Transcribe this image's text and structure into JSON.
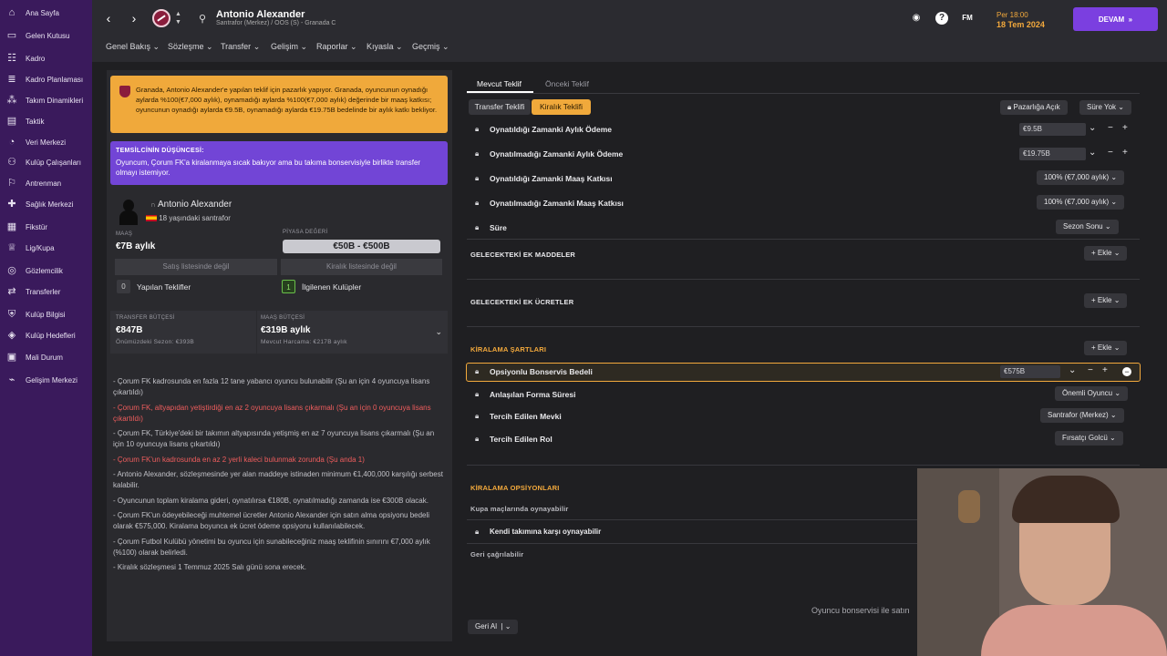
{
  "sidebar": {
    "items": [
      {
        "label": "Ana Sayfa",
        "icon": "home-icon"
      },
      {
        "label": "Gelen Kutusu",
        "icon": "inbox-icon"
      },
      {
        "label": "Kadro",
        "icon": "squad-icon"
      },
      {
        "label": "Kadro Planlaması",
        "icon": "planner-icon"
      },
      {
        "label": "Takım Dinamikleri",
        "icon": "dynamics-icon"
      },
      {
        "label": "Taktik",
        "icon": "tactics-icon"
      },
      {
        "label": "Veri Merkezi",
        "icon": "data-icon"
      },
      {
        "label": "Kulüp Çalışanları",
        "icon": "staff-icon"
      },
      {
        "label": "Antrenman",
        "icon": "training-icon"
      },
      {
        "label": "Sağlık Merkezi",
        "icon": "medical-icon"
      },
      {
        "label": "Fikstür",
        "icon": "calendar-icon"
      },
      {
        "label": "Lig/Kupa",
        "icon": "trophy-icon"
      },
      {
        "label": "Gözlemcilik",
        "icon": "scouting-icon"
      },
      {
        "label": "Transferler",
        "icon": "transfer-icon"
      },
      {
        "label": "Kulüp Bilgisi",
        "icon": "club-icon"
      },
      {
        "label": "Kulüp Hedefleri",
        "icon": "goals-icon"
      },
      {
        "label": "Mali Durum",
        "icon": "finance-icon"
      },
      {
        "label": "Gelişim Merkezi",
        "icon": "development-icon"
      }
    ]
  },
  "header": {
    "player_name": "Antonio Alexander",
    "player_sub": "Santrafor (Merkez) / OOS (S) - Granada C",
    "date_line1": "Per 18:00",
    "date_line2": "18 Tem 2024",
    "fm_label": "FM",
    "help_label": "?",
    "continue_label": "DEVAM",
    "menus": [
      "Genel Bakış",
      "Sözleşme",
      "Transfer",
      "Gelişim",
      "Raporlar",
      "Kıyasla",
      "Geçmiş"
    ]
  },
  "left": {
    "orange_text": "Granada, Antonio Alexander'e yapılan teklif için pazarlık yapıyor. Granada, oyuncunun oynadığı aylarda %100(€7,000 aylık), oynamadığı aylarda %100(€7,000 aylık) değerinde bir maaş katkısı; oyuncunun oynadığı aylarda €9.5B, oynamadığı aylarda €19.75B bedelinde bir aylık katkı bekliyor.",
    "agent_heading": "TEMSİLCİNİN DÜŞÜNCESİ:",
    "agent_text": "Oyuncum, Çorum FK'a kiralanmaya sıcak bakıyor ama bu takıma bonservisiyle birlikte transfer olmayı istemiyor.",
    "player_name": "Antonio Alexander",
    "player_desc": "18 yaşındaki santrafor",
    "wage_label": "MAAŞ",
    "wage_value": "€7B aylık",
    "market_label": "PİYASA DEĞERİ",
    "market_value": "€50B - €500B",
    "not_transfer_listed": "Satış listesinde değil",
    "not_loan_listed": "Kiralık listesinde değil",
    "offers_count": "0",
    "offers_label": "Yapılan Teklifler",
    "interested_count": "1",
    "interested_label": "İlgilenen Kulüpler",
    "transfer_budget_label": "TRANSFER BÜTÇESİ",
    "transfer_budget_value": "€847B",
    "transfer_budget_sub": "Önümüzdeki Sezon: €393B",
    "wage_budget_label": "MAAŞ BÜTÇESİ",
    "wage_budget_value": "€319B aylık",
    "wage_budget_sub": "Mevcut Harcama: €217B aylık",
    "notes": [
      {
        "text": "- Çorum FK kadrosunda en fazla 12 tane yabancı oyuncu bulunabilir (Şu an için 4 oyuncuya lisans çıkartıldı)",
        "red": false
      },
      {
        "text": "- Çorum FK, altyapıdan yetiştirdiği en az 2 oyuncuya lisans çıkarmalı (Şu an için 0 oyuncuya lisans çıkartıldı)",
        "red": true
      },
      {
        "text": "- Çorum FK, Türkiye'deki bir takımın altyapısında yetişmiş en az 7 oyuncuya lisans çıkarmalı (Şu an için 10 oyuncuya lisans çıkartıldı)",
        "red": false
      },
      {
        "text": "- Çorum FK'un kadrosunda en az 2 yerli kaleci bulunmak zorunda (Şu anda 1)",
        "red": true
      },
      {
        "text": "- Antonio Alexander, sözleşmesinde yer alan maddeye istinaden minimum €1,400,000 karşılığı serbest kalabilir.",
        "red": false
      },
      {
        "text": "- Oyuncunun toplam kiralama gideri, oynatılırsa €180B, oynatılmadığı zamanda ise €300B olacak.",
        "red": false
      },
      {
        "text": "- Çorum FK'un ödeyebileceği muhtemel ücretler Antonio Alexander için satın alma opsiyonu bedeli olarak €575,000. Kiralama boyunca ek ücret ödeme opsiyonu kullanılabilecek.",
        "red": false
      },
      {
        "text": "- Çorum Futbol Kulübü yönetimi bu oyuncu için sunabileceğiniz maaş teklifinin sınırını €7,000 aylık (%100) olarak belirledi.",
        "red": false
      },
      {
        "text": "- Kiralık sözleşmesi 1 Temmuz 2025 Salı günü sona erecek.",
        "red": false
      }
    ]
  },
  "right": {
    "tab_current": "Mevcut Teklif",
    "tab_previous": "Önceki Teklif",
    "subtab_transfer": "Transfer Teklifi",
    "subtab_loan": "Kiralık Teklifi",
    "negotiation_label": "Pazarlığa Açık",
    "time_label": "Süre Yok",
    "rows": [
      {
        "label": "Oynatıldığı Zamanki Aylık Ödeme",
        "value": "€9.5B"
      },
      {
        "label": "Oynatılmadığı Zamanki Aylık Ödeme",
        "value": "€19.75B"
      },
      {
        "label": "Oynatıldığı Zamanki Maaş Katkısı",
        "value": "100% (€7,000 aylık)"
      },
      {
        "label": "Oynatılmadığı Zamanki Maaş Katkısı",
        "value": "100% (€7,000 aylık)"
      },
      {
        "label": "Süre",
        "value": "Sezon Sonu"
      }
    ],
    "future_clauses": "GELECEKTEKİ EK MADDELER",
    "future_fees": "GELECEKTEKİ EK ÜCRETLER",
    "add_label": "Ekle",
    "loan_terms": "KİRALAMA ŞARTLARI",
    "option_fee_label": "Opsiyonlu Bonservis Bedeli",
    "option_fee_value": "€575B",
    "terms": [
      {
        "label": "Anlaşılan Forma Süresi",
        "value": "Önemli Oyuncu"
      },
      {
        "label": "Tercih Edilen Mevki",
        "value": "Santrafor (Merkez)"
      },
      {
        "label": "Tercih Edilen Rol",
        "value": "Fırsatçı Golcü"
      }
    ],
    "loan_options": "KİRALAMA OPSİYONLARI",
    "cup_label": "Kupa maçlarında oynayabilir",
    "own_team_label": "Kendi takımına karşı oynayabilir",
    "recall_label": "Geri çağrılabilir",
    "footer_msg": "Oyuncu bonservisi ile satın",
    "undo_label": "Geri Al"
  },
  "colors": {
    "accent": "#7b3fe0",
    "orange": "#f0a93b",
    "sidebar": "#3a1a5c"
  }
}
